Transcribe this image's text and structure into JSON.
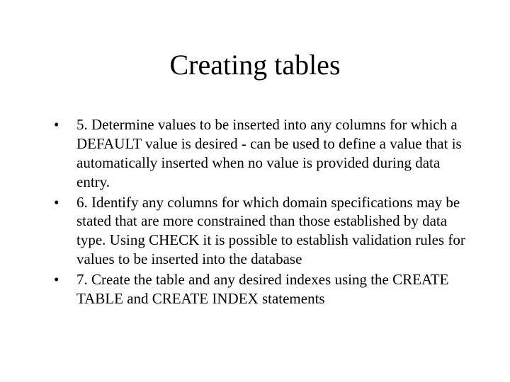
{
  "title": "Creating tables",
  "items": [
    "5. Determine values to be inserted into any columns for which a DEFAULT value is desired - can be used to define a value that is automatically inserted when no value is provided during data entry.",
    "6. Identify any columns for which domain specifications may be stated that are more constrained than those established by data type. Using CHECK it is possible to establish validation rules for values to be inserted into the database",
    "7. Create the table and any desired indexes using the CREATE TABLE and CREATE INDEX statements"
  ]
}
